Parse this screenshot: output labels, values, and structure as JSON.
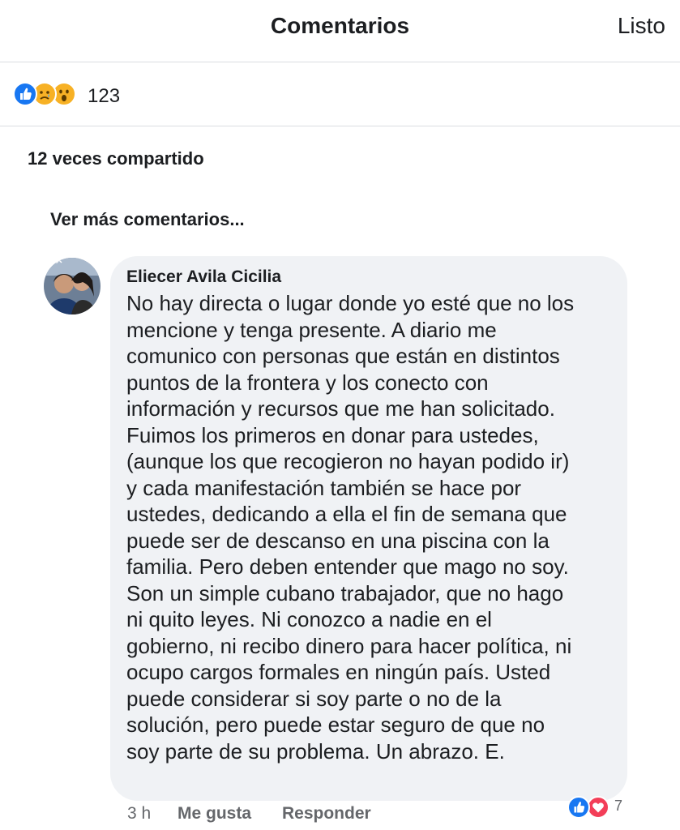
{
  "header": {
    "title": "Comentarios",
    "done_label": "Listo"
  },
  "post_reactions": {
    "icons": [
      "like-icon",
      "sad-icon",
      "wow-icon"
    ],
    "count": "123"
  },
  "shares": {
    "label": "12 veces compartido"
  },
  "see_more": {
    "label": "Ver más comentarios..."
  },
  "comment": {
    "author": "Eliecer Avila Cicilia",
    "lines": [
      "No hay directa o lugar donde yo esté que no los",
      "mencione y tenga presente. A diario me",
      "comunico con personas que están en distintos",
      "puntos de la frontera y los conecto con",
      "información y recursos que me han solicitado.",
      "Fuimos los primeros en donar para ustedes,",
      "(aunque los que recogieron no hayan podido ir)",
      "y cada manifestación también se hace por",
      "ustedes, dedicando a ella el fin de semana que",
      "puede ser de descanso en una piscina con la",
      "familia. Pero deben entender que mago no soy.",
      "Son un simple cubano trabajador, que no hago",
      "ni quito leyes. Ni conozco a nadie en el",
      "gobierno, ni recibo dinero para hacer política, ni",
      "ocupo cargos formales en ningún país. Usted",
      "puede considerar si soy parte o no de la",
      "solución, pero puede estar seguro de que no",
      "soy parte de su problema. Un abrazo. E."
    ],
    "time": "3 h",
    "like_label": "Me gusta",
    "reply_label": "Responder",
    "reactions": {
      "icons": [
        "like-icon",
        "love-icon"
      ],
      "count": "7"
    }
  },
  "colors": {
    "like_blue": "#1877f2",
    "love_red": "#f33e58",
    "emoji_yellow": "#f7b125",
    "bubble_bg": "#f0f2f5",
    "secondary_text": "#65676b",
    "divider": "#dadde1"
  }
}
